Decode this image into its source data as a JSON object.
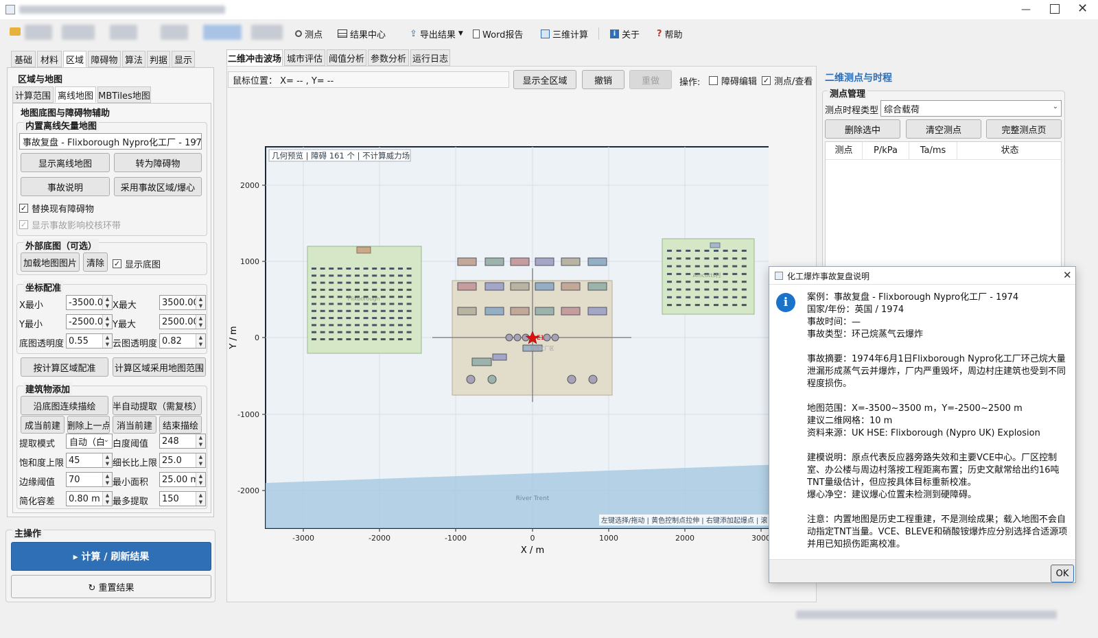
{
  "toolbar": {
    "measure": "测点",
    "results_center": "结果中心",
    "export": "导出结果",
    "word_report": "Word报告",
    "calc3d": "三维计算",
    "about": "关于",
    "help": "帮助"
  },
  "left_tabs": [
    "基础",
    "材料",
    "区域",
    "障碍物",
    "算法",
    "判据",
    "显示"
  ],
  "left": {
    "section_title": "区域与地图",
    "sub_tabs": [
      "计算范围",
      "离线地图",
      "MBTiles地图"
    ],
    "map_group_title": "地图底图与障碍物辅助",
    "builtin_title": "内置离线矢量地图",
    "map_select": "事故复盘 - Flixborough Nypro化工厂 - 1974",
    "btn_show_offline": "显示离线地图",
    "btn_to_obstacle": "转为障碍物",
    "btn_accident_desc": "事故说明",
    "btn_use_area": "采用事故区域/爆心",
    "chk_replace": "替换现有障碍物",
    "chk_show_ring": "显示事故影响校核环带",
    "external_title": "外部底图（可选）",
    "btn_load_image": "加载地图图片",
    "btn_clear": "清除",
    "chk_show_base": "显示底图",
    "coord_title": "坐标配准",
    "xmin_label": "X最小",
    "xmin": "-3500.00",
    "xmax_label": "X最大",
    "xmax": "3500.00",
    "ymin_label": "Y最小",
    "ymin": "-2500.00",
    "ymax_label": "Y最大",
    "ymax": "2500.00",
    "base_opacity_label": "底图透明度",
    "base_opacity": "0.55",
    "cloud_opacity_label": "云图透明度",
    "cloud_opacity": "0.82",
    "btn_fit_calc": "按计算区域配准",
    "btn_use_map_range": "计算区域采用地图范围",
    "building_title": "建筑物添加",
    "btn_trace": "沿底图连续描绘",
    "btn_auto_extract": "半自动提取（需复核）",
    "btn_make_current": "成当前建",
    "btn_delete_last": "删除上一点",
    "btn_cancel_current": "消当前建",
    "btn_end_trace": "结束描绘",
    "extract_mode_label": "提取模式",
    "extract_mode": "自动（白",
    "white_thresh_label": "白度阈值",
    "white_thresh": "248",
    "sat_limit_label": "饱和度上限",
    "sat_limit": "45",
    "aspect_limit_label": "细长比上限",
    "aspect_limit": "25.0",
    "edge_thresh_label": "边缘阈值",
    "edge_thresh": "70",
    "min_area_label": "最小面积",
    "min_area": "25.00 m",
    "simplify_label": "简化容差",
    "simplify": "0.80 m",
    "max_extract_label": "最多提取",
    "max_extract": "150",
    "main_ops_title": "主操作",
    "btn_compute": "▸ 计算 / 刷新结果",
    "btn_reset": "↻ 重置结果"
  },
  "center_tabs": [
    "二维冲击波场",
    "城市评估",
    "阈值分析",
    "参数分析",
    "运行日志"
  ],
  "center": {
    "mouse_pos": "鼠标位置： X= -- , Y= --",
    "btn_show_all": "显示全区域",
    "btn_undo": "撤销",
    "btn_redo": "重做",
    "ops_label": "操作:",
    "chk_obstacle_edit": "障碍编辑",
    "chk_point_view": "测点/查看",
    "plot_status": "几何预览 | 障碍 161 个 | 不计算威力场",
    "hint": "左键选择/拖动 | 黄色控制点拉伸 | 右键添加起爆点 | 滚",
    "river_label": "River Trent",
    "village_left": "Flixborough",
    "village_right": "Amcotts村",
    "plant_label": "现场工厂区",
    "center_marker": "E1",
    "xlabel": "X / m",
    "ylabel": "Y / m",
    "xticks": [
      "-3000",
      "-2000",
      "-1000",
      "0",
      "1000",
      "2000",
      "3000"
    ],
    "yticks": [
      "2000",
      "1000",
      "0",
      "-1000",
      "-2000"
    ]
  },
  "right": {
    "title": "二维测点与时程",
    "group_title": "测点管理",
    "type_label": "测点时程类型",
    "type_value": "综合载荷",
    "btn_delete_sel": "删除选中",
    "btn_clear_points": "清空测点",
    "btn_full_page": "完整测点页",
    "columns": [
      "测点",
      "P/kPa",
      "Ta/ms",
      "状态"
    ]
  },
  "dialog": {
    "title": "化工爆炸事故复盘说明",
    "info_icon": "i",
    "lines1": [
      "案例：事故复盘 - Flixborough Nypro化工厂 - 1974",
      "国家/年份：英国 / 1974",
      "事故时间：—",
      "事故类型：环己烷蒸气云爆炸"
    ],
    "summary": "事故摘要：1974年6月1日Flixborough Nypro化工厂环己烷大量泄漏形成蒸气云并爆炸，厂内严重毁坏，周边村庄建筑也受到不同程度损伤。",
    "lines2": [
      "地图范围：X=-3500~3500 m，Y=-2500~2500 m",
      "建议二维网格：10 m",
      "资料来源：UK HSE: Flixborough (Nypro UK) Explosion"
    ],
    "model": "建模说明：原点代表反应器旁路失效和主要VCE中心。厂区控制室、办公楼与周边村落按工程距离布置；历史文献常给出约16吨TNT量级估计，但应按具体目标重新校准。",
    "center_clear": "爆心净空：建议爆心位置未检测到硬障碍。",
    "note": "注意：内置地图是历史工程重建，不是测绘成果；载入地图不会自动指定TNT当量。VCE、BLEVE和硝酸铵爆炸应分别选择合适源项并用已知损伤距离校准。",
    "ok": "OK"
  },
  "colors": {
    "accent": "#2f6fb6",
    "info": "#1a73c8",
    "river": "#a9cbe3"
  }
}
